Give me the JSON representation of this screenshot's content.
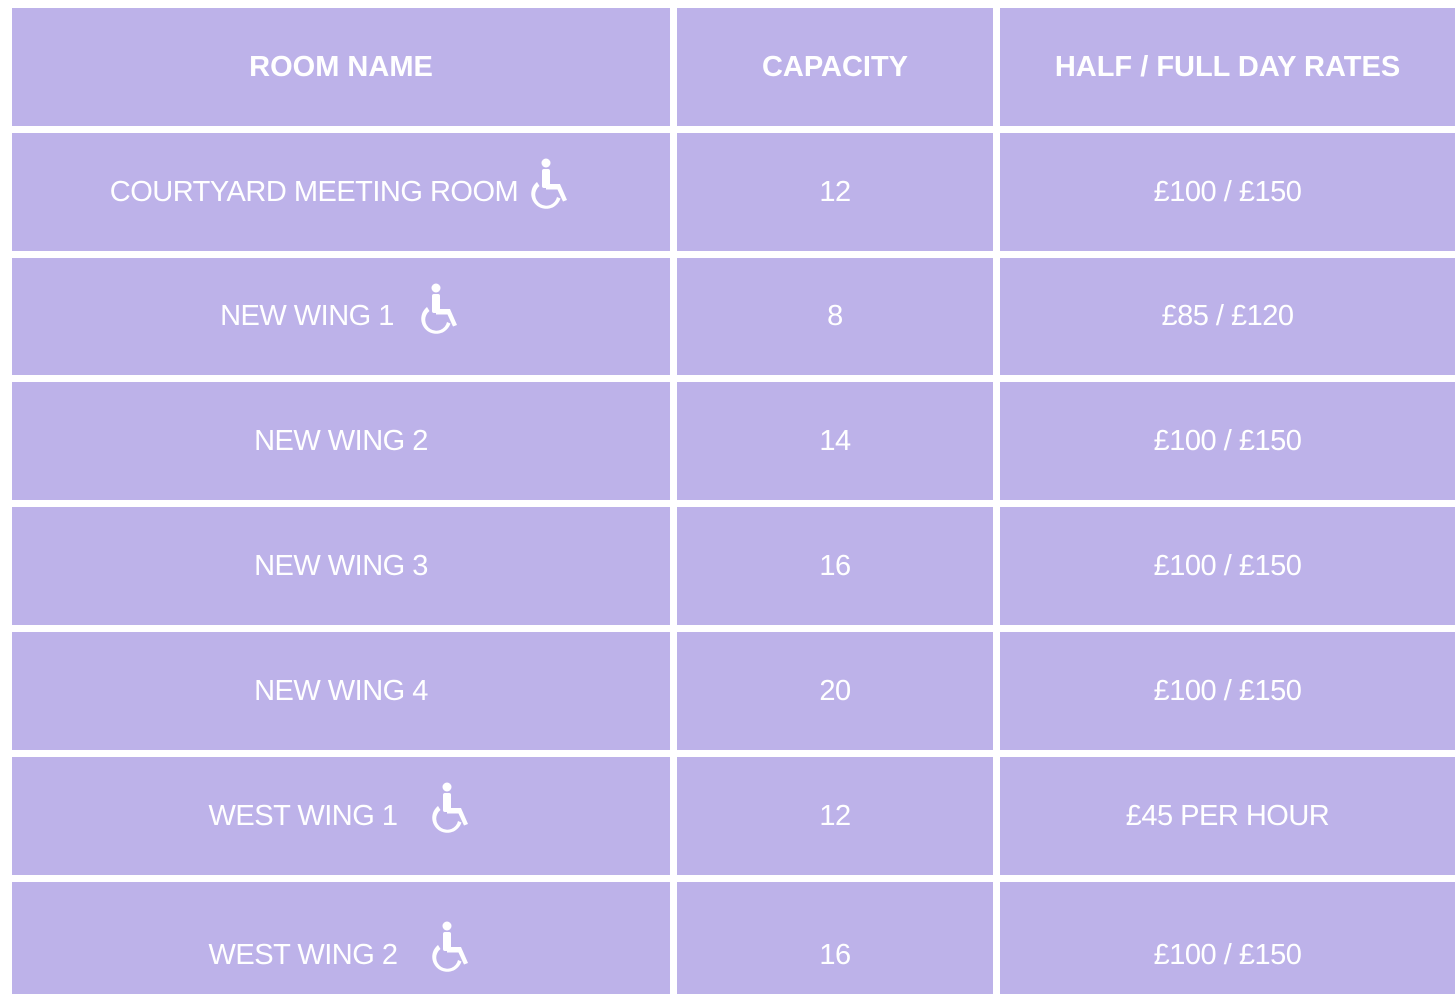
{
  "table": {
    "headers": [
      "ROOM NAME",
      "CAPACITY",
      "HALF / FULL DAY RATES"
    ],
    "rows": [
      {
        "name": "COURTYARD MEETING ROOM",
        "capacity": "12",
        "rate": "£100 / £150",
        "icon": "wheelchair-accessible-icon"
      },
      {
        "name": "NEW WING 1",
        "capacity": "8",
        "rate": "£85 / £120",
        "icon": "wheelchair-accessible-icon"
      },
      {
        "name": "NEW WING 2",
        "capacity": "14",
        "rate": "£100 / £150"
      },
      {
        "name": "NEW WING 3",
        "capacity": "16",
        "rate": "£100 / £150"
      },
      {
        "name": "NEW WING 4",
        "capacity": "20",
        "rate": "£100 / £150"
      },
      {
        "name": "WEST WING 1",
        "capacity": "12",
        "rate": "£45 PER HOUR",
        "icon": "wheelchair-accessible-icon"
      },
      {
        "name": "WEST WING 2",
        "capacity": "16",
        "rate": "£100 / £150",
        "icon": "wheelchair-accessible-icon"
      }
    ]
  },
  "colors": {
    "cell_background": "#bdb2e9",
    "grid_lines": "#ffffff",
    "text": "#ffffff"
  }
}
